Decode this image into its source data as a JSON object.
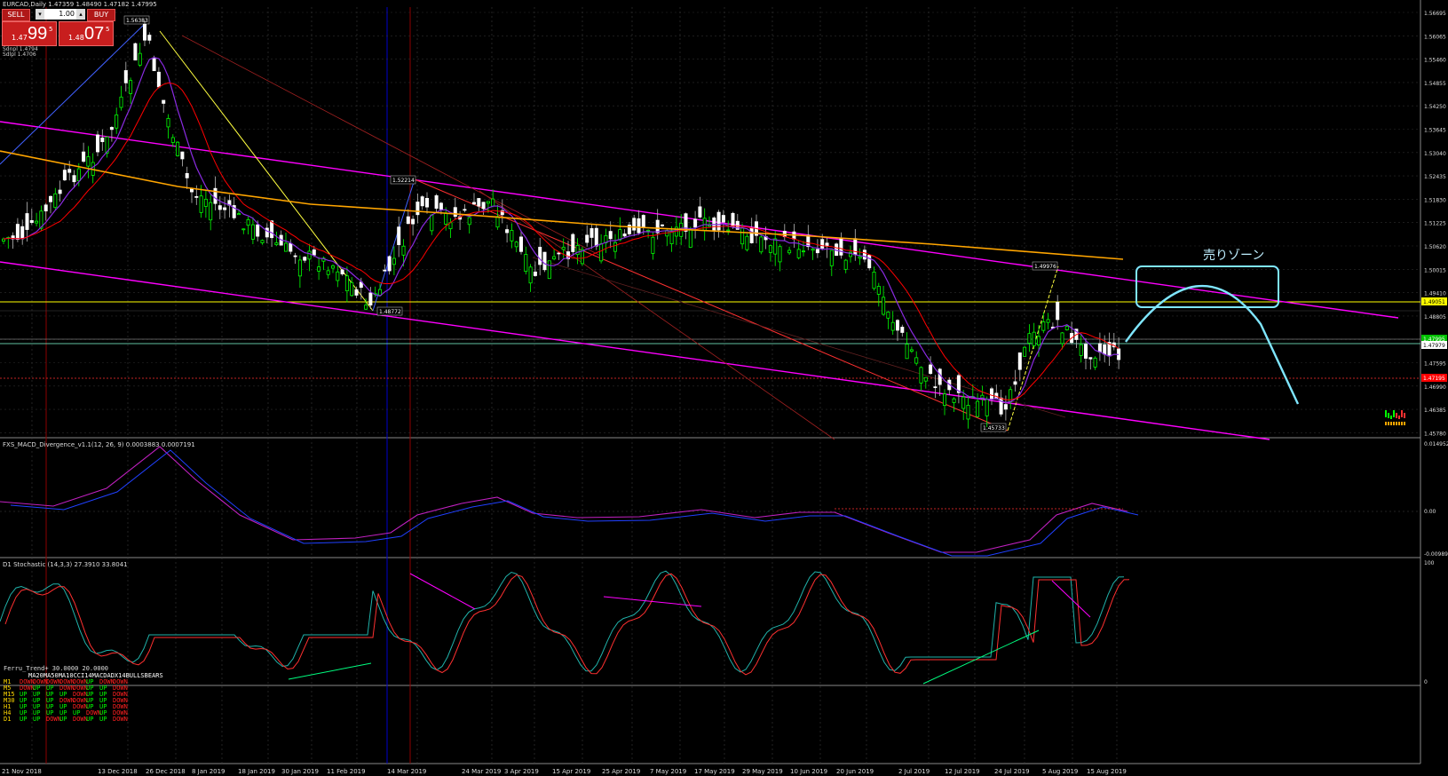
{
  "window": {
    "title": "EURCAD,Daily  1.47359 1.48490 1.47182 1.47995"
  },
  "trade_panel": {
    "sell_label": "SELL",
    "buy_label": "BUY",
    "lot_value": "1.00",
    "sell_price": {
      "prefix": "1.47",
      "big": "99",
      "sup": "5"
    },
    "buy_price": {
      "prefix": "1.48",
      "big": "07",
      "sup": "5"
    },
    "sub_info_1": "Sdnpl 1.4794",
    "sub_info_2": "Sdlpl 1.4706"
  },
  "colors": {
    "up_candle": "#00ff00",
    "down_candle": "#ffffff",
    "magenta_line": "#ff00ff",
    "orange_ma": "#ffa500",
    "red_ma": "#ff0000",
    "purple_ma": "#8a2be2",
    "cyan_zone": "#7fe6ff",
    "horizontal_yellow": "#ffff00"
  },
  "price_axis": {
    "labels": [
      "1.56695",
      "1.56065",
      "1.55460",
      "1.54855",
      "1.54250",
      "1.53645",
      "1.53040",
      "1.52435",
      "1.51830",
      "1.51225",
      "1.50620",
      "1.50015",
      "1.49410",
      "1.48805",
      "1.48200",
      "1.47595",
      "1.46990",
      "1.46385",
      "1.45780"
    ],
    "badges": [
      {
        "text": "1.49051",
        "color": "#ffff00"
      },
      {
        "text": "1.47995",
        "color": "#00c000"
      },
      {
        "text": "1.47979",
        "color": "#ffffff"
      },
      {
        "text": "1.47195",
        "color": "#ff0000"
      }
    ]
  },
  "price_annotations": [
    "1.56383",
    "1.52214",
    "1.48772",
    "1.49976",
    "1.45733"
  ],
  "zone_label": "売りゾーン",
  "date_axis": [
    "21 Nov 2018",
    "13 Dec 2018",
    "26 Dec 2018",
    "8 Jan 2019",
    "18 Jan 2019",
    "30 Jan 2019",
    "11 Feb 2019",
    "14 Mar 2019",
    "24 Mar 2019",
    "3 Apr 2019",
    "15 Apr 2019",
    "25 Apr 2019",
    "7 May 2019",
    "17 May 2019",
    "29 May 2019",
    "10 Jun 2019",
    "20 Jun 2019",
    "2 Jul 2019",
    "12 Jul 2019",
    "24 Jul 2019",
    "5 Aug 2019",
    "15 Aug 2019"
  ],
  "macd": {
    "title": "FXS_MACD_Divergence_v1.1(12, 26, 9) 0.0003883 0.0007191",
    "axis": [
      "0.0149524",
      "0.00",
      "-0.0098981"
    ]
  },
  "stoch": {
    "title": "D1 Stochastic (14,3,3) 27.3910 33.8041",
    "axis": [
      "100",
      "0"
    ]
  },
  "trend_panel": {
    "title": "Ferru_Trend+ 30.0000 20.0000",
    "header": [
      "MA20",
      "MA50",
      "MA10",
      "CCI14",
      "MACD",
      "ADX14",
      "BULLS",
      "BEARS"
    ],
    "rows": [
      {
        "tf": "M1",
        "vals": [
          "DOWN",
          "DOWN",
          "DOWN",
          "DOWN",
          "DOWN",
          "UP",
          "DOWN",
          "DOWN"
        ]
      },
      {
        "tf": "M5",
        "vals": [
          "DOWN",
          "UP",
          "UP",
          "DOWN",
          "DOWN",
          "UP",
          "UP",
          "DOWN"
        ]
      },
      {
        "tf": "M15",
        "vals": [
          "UP",
          "UP",
          "UP",
          "UP",
          "DOWN",
          "UP",
          "UP",
          "DOWN"
        ]
      },
      {
        "tf": "M30",
        "vals": [
          "UP",
          "UP",
          "UP",
          "DOWN",
          "DOWN",
          "UP",
          "UP",
          "DOWN"
        ]
      },
      {
        "tf": "H1",
        "vals": [
          "UP",
          "UP",
          "UP",
          "UP",
          "DOWN",
          "UP",
          "UP",
          "DOWN"
        ]
      },
      {
        "tf": "H4",
        "vals": [
          "UP",
          "UP",
          "UP",
          "UP",
          "UP",
          "DOWN",
          "UP",
          "DOWN"
        ]
      },
      {
        "tf": "D1",
        "vals": [
          "UP",
          "UP",
          "DOWN",
          "UP",
          "DOWN",
          "UP",
          "UP",
          "DOWN"
        ]
      }
    ]
  }
}
